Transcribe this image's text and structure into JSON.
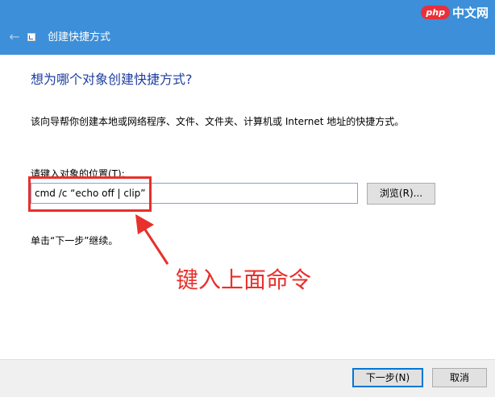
{
  "window": {
    "title": "创建快捷方式",
    "titlebar_color": "#3c8fd8"
  },
  "watermark": {
    "logo": "php",
    "text": "中文网"
  },
  "content": {
    "heading": "想为哪个对象创建快捷方式?",
    "description": "该向导帮你创建本地或网络程序、文件、文件夹、计算机或 Internet 地址的快捷方式。",
    "field_label": "请键入对象的位置(T):",
    "field_value": "cmd /c “echo off | clip”",
    "browse_label": "浏览(R)...",
    "hint": "单击“下一步”继续。"
  },
  "annotation": {
    "text": "键入上面命令",
    "color": "#e8302c"
  },
  "footer": {
    "next_label": "下一步(N)",
    "cancel_label": "取消"
  }
}
